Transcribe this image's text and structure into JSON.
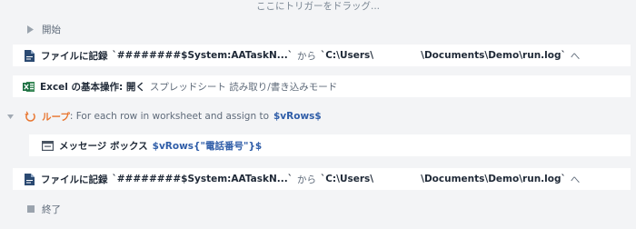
{
  "canvas": {
    "drop_hint": "ここにトリガーをドラッグ..."
  },
  "flow": {
    "start": {
      "label": "開始"
    },
    "log1": {
      "title": "ファイルに記録",
      "text": "`########$System:AATaskN...`",
      "from": "から",
      "path_start": "`C:\\Users\\",
      "path_end": "\\Documents\\Demo\\run.log`",
      "to": "へ"
    },
    "excel": {
      "title": "Excel の基本操作: 開く",
      "desc": "スプレッドシート 読み取り/書き込みモード"
    },
    "loop": {
      "title": "ループ",
      "desc": ": For each row in worksheet and assign to",
      "variable": "$vRows$"
    },
    "msgbox": {
      "title": "メッセージ ボックス",
      "variable": "$vRows{\"電話番号\"}$"
    },
    "log2": {
      "title": "ファイルに記録",
      "text": "`########$System:AATaskN...`",
      "from": "から",
      "path_start": "`C:\\Users\\",
      "path_end": "\\Documents\\Demo\\run.log`",
      "to": "へ"
    },
    "end": {
      "label": "終了"
    }
  },
  "icons": {
    "start": "play-triangle-icon",
    "log": "log-file-icon",
    "excel": "excel-icon",
    "loop": "loop-icon",
    "loop_toggle": "collapse-caret-icon",
    "msgbox": "message-box-icon",
    "end": "stop-square-icon"
  },
  "colors": {
    "loop_accent": "#e8742d",
    "variable": "#2f5da8",
    "excel_green": "#1d6f42",
    "file_icon": "#2b4a72"
  }
}
